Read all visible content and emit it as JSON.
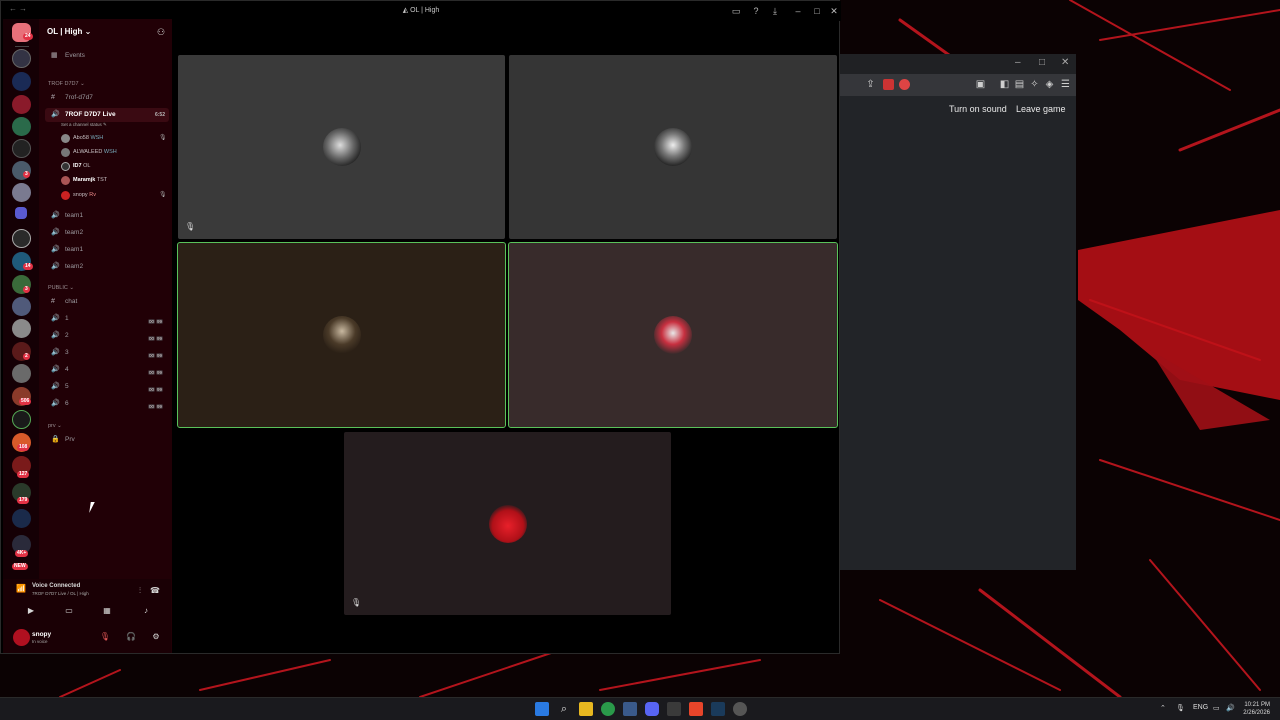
{
  "colors": {
    "accent_red": "#e23245",
    "speaking_green": "#5ac25a",
    "sidebar_bg": "#210006",
    "stage_bg": "#000000"
  },
  "discord": {
    "window_title": "OL | High",
    "server_name": "OL | High",
    "events_label": "Events",
    "categories": [
      {
        "label": "TROF D7D7"
      },
      {
        "label": "PUBLIC"
      },
      {
        "label": "prv"
      }
    ],
    "text_channel_trof": "7rof-d7d7",
    "live_channel": {
      "name": "7ROF D7D7 Live",
      "time": "6:52",
      "status_hint": "Set a channel status"
    },
    "voice_members": [
      {
        "name": "Abo58",
        "tag": "WSH"
      },
      {
        "name": "ALWALEED",
        "tag": "WSH"
      },
      {
        "name": "ID7",
        "tag": "OL"
      },
      {
        "name": "Maramjk",
        "tag": "TST"
      },
      {
        "name": "snopy",
        "tag": "Rv"
      }
    ],
    "team_channels": [
      "team1",
      "team2",
      "team1",
      "team2"
    ],
    "chat_channel": "chat",
    "public_voice": [
      {
        "name": "1",
        "a": "00",
        "b": "99"
      },
      {
        "name": "2",
        "a": "00",
        "b": "99"
      },
      {
        "name": "3",
        "a": "00",
        "b": "99"
      },
      {
        "name": "4",
        "a": "00",
        "b": "99"
      },
      {
        "name": "5",
        "a": "00",
        "b": "99"
      },
      {
        "name": "6",
        "a": "00",
        "b": "99"
      }
    ],
    "prv_channel": "Prv",
    "rail_badges": [
      "24",
      "3",
      "14",
      "3",
      "2",
      "506",
      "108",
      "127",
      "179",
      "4K+",
      "NEW"
    ],
    "voice_panel": {
      "status": "Voice Connected",
      "channel": "7ROF D7D7 Live / OL | High",
      "user_name": "snopy",
      "user_status": "In voice"
    }
  },
  "browser": {
    "turn_on_sound": "Turn on sound",
    "leave_game": "Leave game"
  },
  "taskbar": {
    "lang": "ENG",
    "time": "10:21 PM",
    "date": "2/26/2026"
  }
}
